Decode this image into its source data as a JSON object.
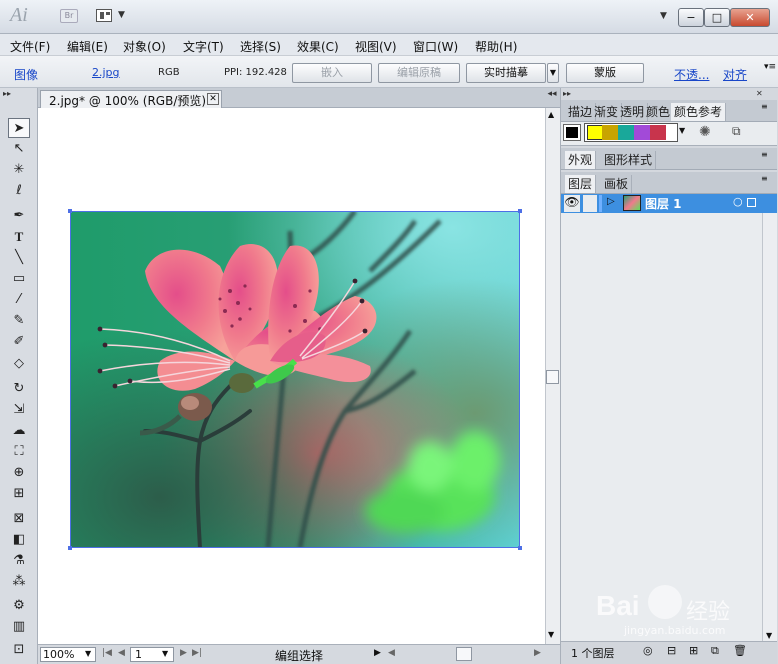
{
  "titlebar": {
    "app_logo": "Ai",
    "bridge_logo": "Br",
    "layout_icon": "layout-grid-icon",
    "controls": {
      "minimize": "−",
      "maximize": "□",
      "close": "✕"
    }
  },
  "menubar": {
    "items": [
      "文件(F)",
      "编辑(E)",
      "对象(O)",
      "文字(T)",
      "选择(S)",
      "效果(C)",
      "视图(V)",
      "窗口(W)",
      "帮助(H)"
    ]
  },
  "controlbar": {
    "type_label": "图像",
    "file_name": "2.jpg",
    "color_mode": "RGB",
    "ppi": "PPI: 192.428",
    "embed_button": "嵌入",
    "edit_original_button": "编辑原稿",
    "live_trace_button": "实时描摹",
    "mask_button": "蒙版",
    "opacity_link": "不透...",
    "align_link": "对齐"
  },
  "document": {
    "tab_title": "2.jpg* @ 100% (RGB/预览)",
    "tab_close": "✕"
  },
  "statusbar": {
    "zoom": "100%",
    "page": "1",
    "mode": "编组选择"
  },
  "panels": {
    "top_tabs": [
      "描边",
      "渐变",
      "透明",
      "颜色",
      "颜色参考"
    ],
    "mid_tabs": [
      "外观",
      "图形样式"
    ],
    "layer_tabs": [
      "图层",
      "画板"
    ],
    "layer_name": "图层 1",
    "layer_count": "1 个图层",
    "swatch_colors": [
      "#000000",
      "#ffff00",
      "#c8a400",
      "#19a89a",
      "#a24ad8",
      "#c8344c"
    ]
  },
  "watermark": {
    "brand": "Bai",
    "brand_cn": "经验",
    "url": "jingyan.baidu.com"
  }
}
